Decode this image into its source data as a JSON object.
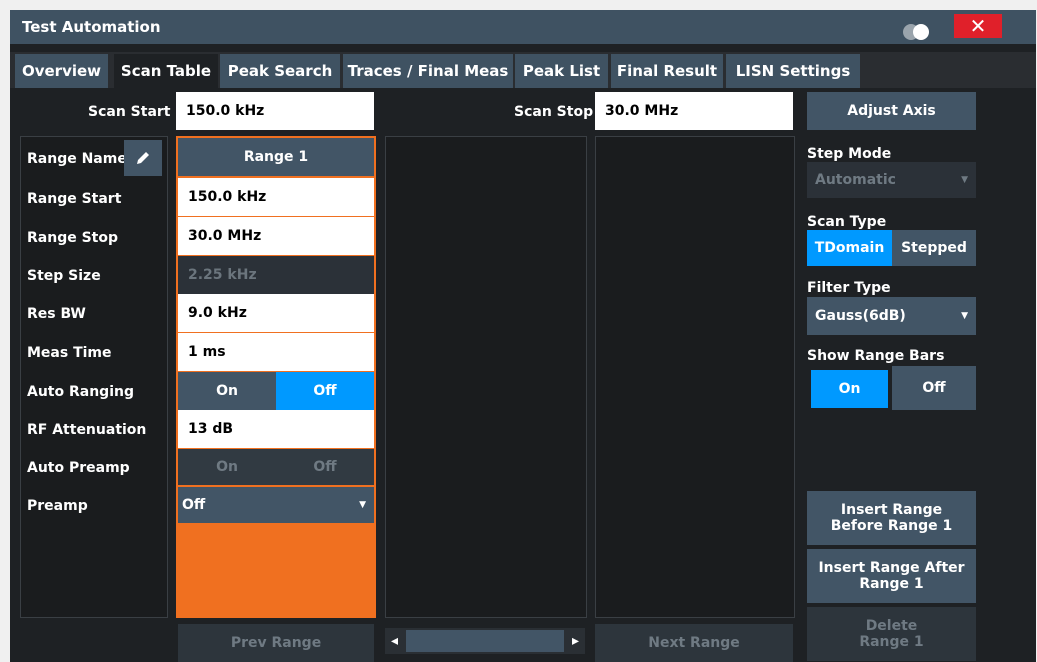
{
  "window": {
    "title": "Test Automation",
    "close_label": "✕",
    "toggle_icon": "toggle-icon"
  },
  "tabs": [
    {
      "label": "Overview"
    },
    {
      "label": "Scan Table"
    },
    {
      "label": "Peak Search"
    },
    {
      "label": "Traces / Final Meas"
    },
    {
      "label": "Peak List"
    },
    {
      "label": "Final Result"
    },
    {
      "label": "LISN Settings"
    }
  ],
  "scan": {
    "start_label": "Scan Start",
    "start_value": "150.0 kHz",
    "stop_label": "Scan Stop",
    "stop_value": "30.0 MHz",
    "adjust_axis": "Adjust Axis"
  },
  "rows": {
    "range_name": "Range Name",
    "range_start": "Range Start",
    "range_stop": "Range Stop",
    "step_size": "Step Size",
    "res_bw": "Res BW",
    "meas_time": "Meas Time",
    "auto_ranging": "Auto Ranging",
    "rf_attenuation": "RF Attenuation",
    "auto_preamp": "Auto Preamp",
    "preamp": "Preamp"
  },
  "range1": {
    "name": "Range 1",
    "start": "150.0 kHz",
    "stop": "30.0 MHz",
    "step_size": "2.25 kHz",
    "res_bw": "9.0 kHz",
    "meas_time": "1 ms",
    "auto_ranging_on": "On",
    "auto_ranging_off": "Off",
    "rf_attenuation": "13 dB",
    "auto_preamp_on": "On",
    "auto_preamp_off": "Off",
    "preamp": "Off"
  },
  "right": {
    "step_mode_label": "Step Mode",
    "step_mode_value": "Automatic",
    "scan_type_label": "Scan Type",
    "scan_type_tdomain": "TDomain",
    "scan_type_stepped": "Stepped",
    "filter_type_label": "Filter Type",
    "filter_type_value": "Gauss(6dB)",
    "show_range_bars_label": "Show Range Bars",
    "show_range_bars_on": "On",
    "show_range_bars_off": "Off",
    "insert_before": "Insert Range Before Range 1",
    "insert_after": "Insert Range After Range 1",
    "delete_line1": "Delete",
    "delete_line2": "Range 1"
  },
  "bottom": {
    "prev_range": "Prev Range",
    "next_range": "Next Range"
  },
  "colors": {
    "accent": "#0099ff",
    "range_border": "#f07020",
    "close": "#e0202a"
  }
}
